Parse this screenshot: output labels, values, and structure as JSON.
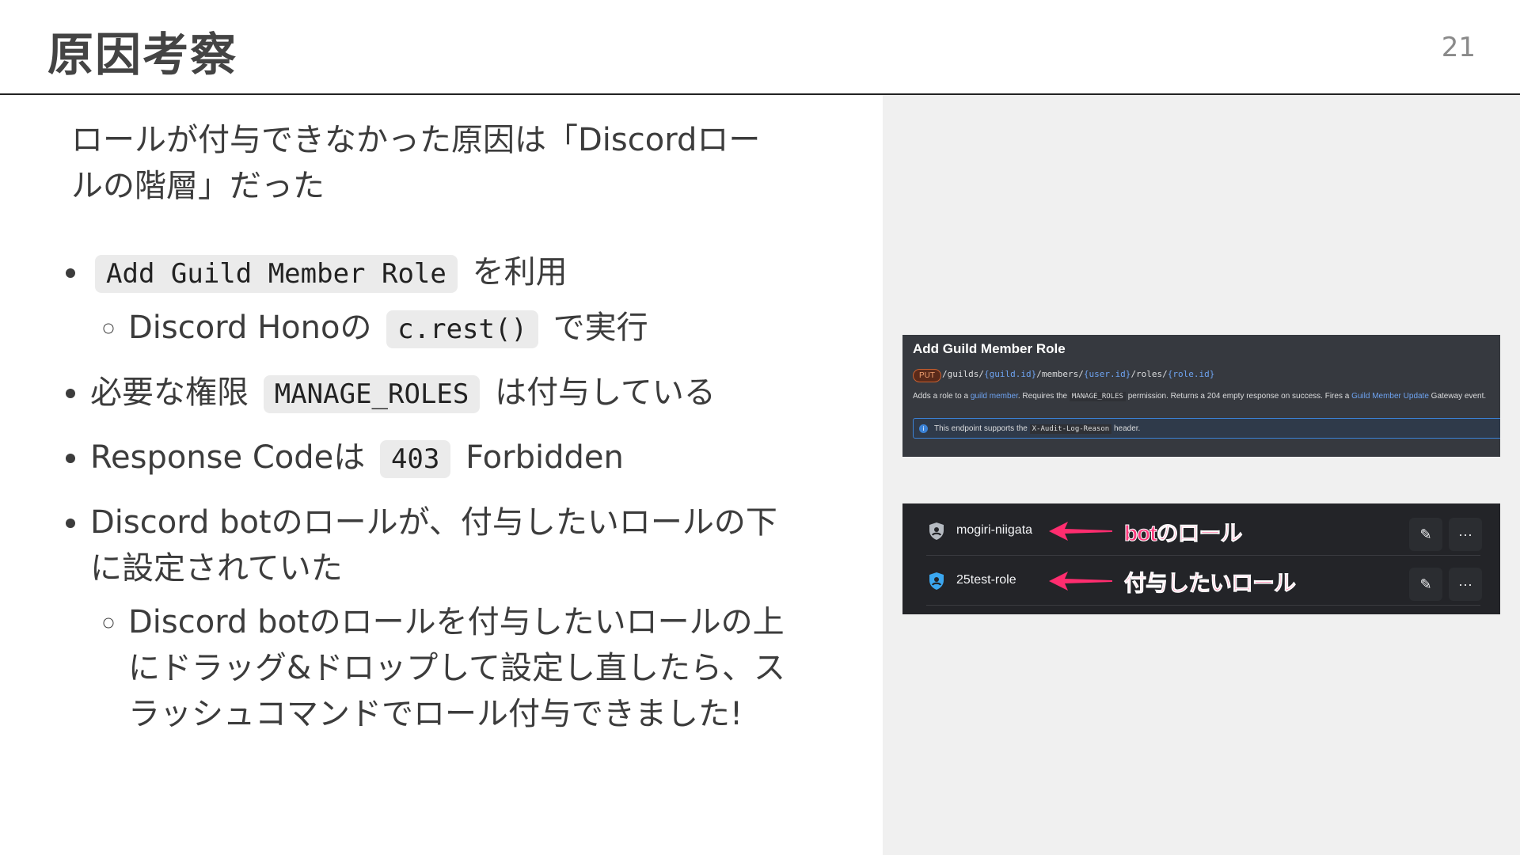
{
  "header": {
    "title": "原因考察",
    "page_number": "21"
  },
  "lead": "ロールが付与できなかった原因は「Discordロールの階層」だった",
  "bullets": {
    "b1": {
      "code": "Add Guild Member Role",
      "after": "を利用"
    },
    "b1_sub": {
      "before": "Discord Honoの",
      "code": "c.rest()",
      "after": "で実行"
    },
    "b2": {
      "before": "必要な権限",
      "code": "MANAGE_ROLES",
      "after": "は付与している"
    },
    "b3": {
      "before": "Response Codeは",
      "code": "403",
      "after": "Forbidden"
    },
    "b4": "Discord botのロールが、付与したいロールの下に設定されていた",
    "b4_sub": "Discord botのロールを付与したいロールの上にドラッグ&ドロップして設定し直したら、スラッシュコマンドでロール付与できました!"
  },
  "api_doc": {
    "title": "Add Guild Member Role",
    "method": "PUT",
    "path_parts": [
      "/guilds/",
      "{guild.id}",
      "/members/",
      "{user.id}",
      "/roles/",
      "{role.id}"
    ],
    "desc_1": "Adds a role to a ",
    "desc_link_1": "guild member",
    "desc_2": ". Requires the ",
    "desc_code": "MANAGE_ROLES",
    "desc_3": " permission. Returns a 204 empty response on success. Fires a ",
    "desc_link_2": "Guild Member Update",
    "desc_4": " Gateway event.",
    "note_1": "This endpoint supports the ",
    "note_code": "X-Audit-Log-Reason",
    "note_2": " header.",
    "info_glyph": "i"
  },
  "roles": [
    {
      "name": "mogiri-niigata",
      "annotation": "botのロール",
      "icon_color": "#b5bac1"
    },
    {
      "name": "25test-role",
      "annotation": "付与したいロール",
      "icon_color": "#3ba7f0"
    }
  ],
  "role_buttons": {
    "edit_glyph": "✎",
    "more_glyph": "···"
  },
  "colors": {
    "annotation": "#ff3d7f",
    "arrow": "#ff2d6f",
    "link": "#6ea3f0"
  }
}
